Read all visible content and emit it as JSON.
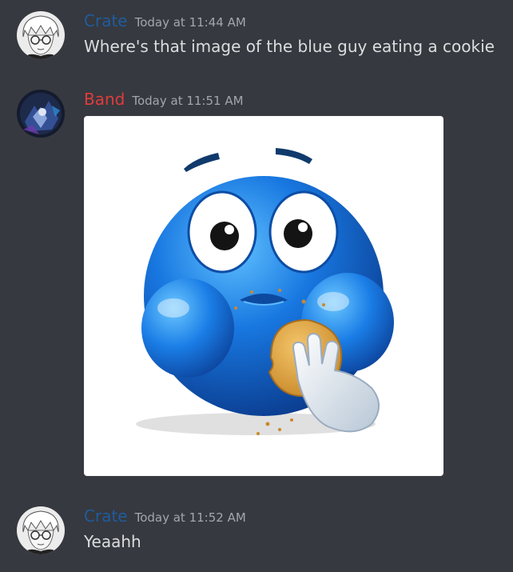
{
  "messages": [
    {
      "username": "Crate",
      "timestamp": "Today at 11:44 AM",
      "text": "Where's that image of the blue guy eating a cookie",
      "username_color": "#1f5c9e",
      "avatar": "anime-boy-glasses-avatar"
    },
    {
      "username": "Band",
      "timestamp": "Today at 11:51 AM",
      "attachment": "blue-emoji-eating-cookie-image",
      "username_color": "#e03c3c",
      "avatar": "dark-character-art-avatar"
    },
    {
      "username": "Crate",
      "timestamp": "Today at 11:52 AM",
      "text": "Yeaahh",
      "username_color": "#1f5c9e",
      "avatar": "anime-boy-glasses-avatar"
    }
  ],
  "theme": {
    "background": "#36393f",
    "text": "#dcddde",
    "timestamp": "#a3a6aa"
  }
}
